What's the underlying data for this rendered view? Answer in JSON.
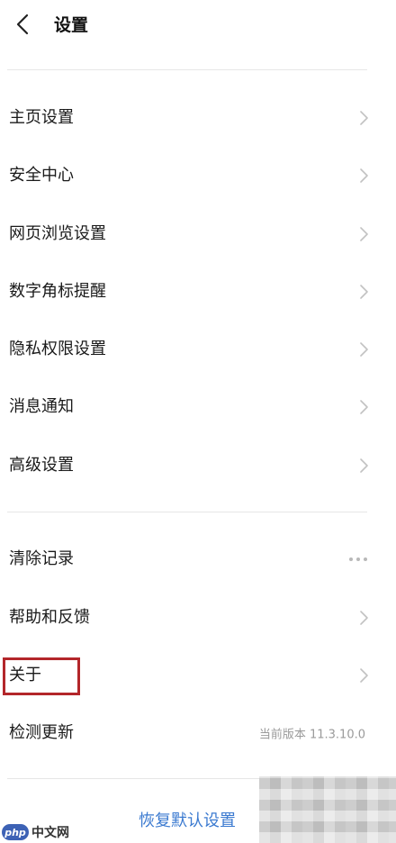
{
  "header": {
    "title": "设置"
  },
  "sections": [
    {
      "items": [
        {
          "label": "主页设置",
          "trailing": "chevron"
        },
        {
          "label": "安全中心",
          "trailing": "chevron"
        },
        {
          "label": "网页浏览设置",
          "trailing": "chevron"
        },
        {
          "label": "数字角标提醒",
          "trailing": "chevron"
        },
        {
          "label": "隐私权限设置",
          "trailing": "chevron"
        },
        {
          "label": "消息通知",
          "trailing": "chevron"
        },
        {
          "label": "高级设置",
          "trailing": "chevron"
        }
      ]
    },
    {
      "items": [
        {
          "label": "清除记录",
          "trailing": "more-dots"
        },
        {
          "label": "帮助和反馈",
          "trailing": "chevron"
        },
        {
          "label": "关于",
          "trailing": "chevron"
        },
        {
          "label": "检测更新",
          "trailing": "version",
          "value": "当前版本 11.3.10.0"
        }
      ]
    }
  ],
  "footer": {
    "restore_label": "恢复默认设置"
  },
  "watermark": {
    "logo_text": "php",
    "site_text": "中文网"
  },
  "colors": {
    "accent": "#3b7ad0",
    "highlight": "#b3262a",
    "secondary_text": "#9a9a9a",
    "divider": "#e6e6e6"
  }
}
